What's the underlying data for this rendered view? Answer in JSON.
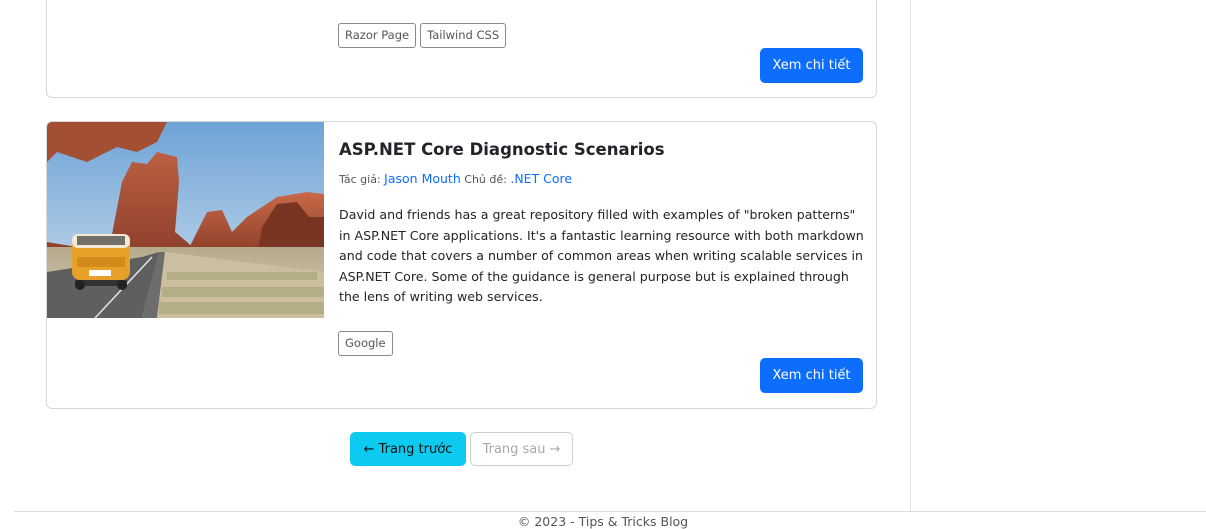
{
  "top_card": {
    "tags": [
      "Razor Page",
      "Tailwind CSS"
    ],
    "detail_button": "Xem chi tiết"
  },
  "post": {
    "title": "ASP.NET Core Diagnostic Scenarios",
    "author_label": "Tác giả:",
    "author": "Jason Mouth",
    "topic_label": "Chủ đề:",
    "topic": ".NET Core",
    "description": "David and friends has a great repository filled with examples of \"broken patterns\" in ASP.NET Core applications. It's a fantastic learning resource with both markdown and code that covers a number of common areas when writing scalable services in ASP.NET Core. Some of the guidance is general purpose but is explained through the lens of writing web services.",
    "tags": [
      "Google"
    ],
    "detail_button": "Xem chi tiết"
  },
  "pagination": {
    "prev_label": "Trang trước",
    "next_label": "Trang sau"
  },
  "footer": {
    "text": "© 2023 - Tips & Tricks Blog"
  },
  "colors": {
    "primary": "#0d6efd",
    "info": "#0dcaf0"
  }
}
